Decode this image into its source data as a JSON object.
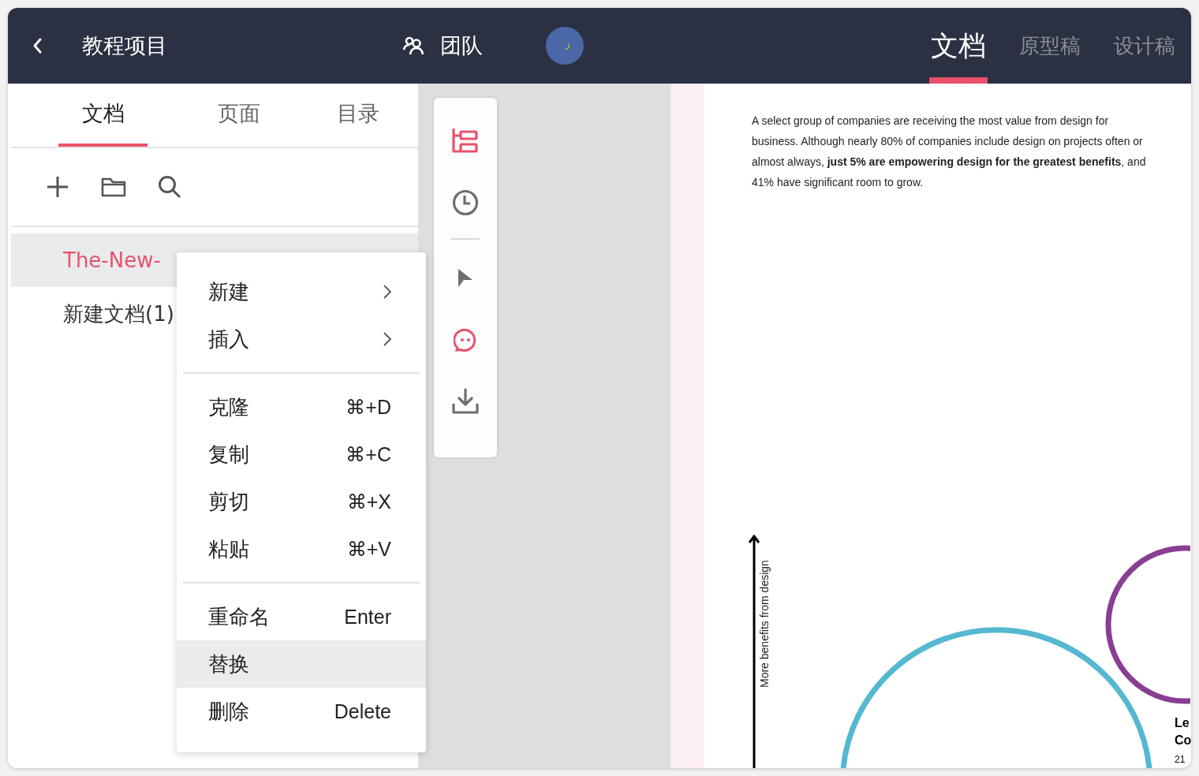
{
  "header": {
    "project_title": "教程项目",
    "team_label": "团队",
    "tabs": [
      {
        "label": "文档",
        "selected": true
      },
      {
        "label": "原型稿",
        "selected": false
      },
      {
        "label": "设计稿",
        "selected": false
      }
    ]
  },
  "sidebar": {
    "tabs": [
      {
        "label": "文档",
        "selected": true
      },
      {
        "label": "页面",
        "selected": false
      },
      {
        "label": "目录",
        "selected": false
      }
    ],
    "items": [
      {
        "label": "The-New-",
        "selected": true
      },
      {
        "label": "新建文档(1)",
        "selected": false
      }
    ]
  },
  "context_menu": {
    "groups": [
      [
        {
          "kind": "submenu",
          "label": "新建",
          "selected": false
        },
        {
          "kind": "submenu",
          "label": "插入",
          "selected": false
        }
      ],
      [
        {
          "kind": "shortcut",
          "label": "克隆",
          "shortcut": "⌘+D",
          "selected": false
        },
        {
          "kind": "shortcut",
          "label": "复制",
          "shortcut": "⌘+C",
          "selected": false
        },
        {
          "kind": "shortcut",
          "label": "剪切",
          "shortcut": "⌘+X",
          "selected": false
        },
        {
          "kind": "shortcut",
          "label": "粘贴",
          "shortcut": "⌘+V",
          "selected": false
        }
      ],
      [
        {
          "kind": "shortcut",
          "label": "重命名",
          "shortcut": "Enter",
          "selected": false
        },
        {
          "kind": "plain",
          "label": "替换",
          "selected": true
        },
        {
          "kind": "shortcut",
          "label": "删除",
          "shortcut": "Delete",
          "selected": false
        }
      ]
    ]
  },
  "toolbar": {
    "tools": [
      {
        "kind": "tree",
        "active": true
      },
      {
        "kind": "history",
        "active": false
      },
      {
        "kind": "divider"
      },
      {
        "kind": "pointer",
        "active": false
      },
      {
        "kind": "comment",
        "active": true
      },
      {
        "kind": "download",
        "active": false
      }
    ]
  },
  "document": {
    "paragraph": "A select group of companies are receiving the most value from design for business. Although nearly 80% of companies include design on projects often or almost always, **just 5% are empowering design for the greatest benefits**, and 41% have significant room to grow.",
    "axis_label": "More benefits from design",
    "cut_label_lines": [
      "Le",
      "Co"
    ],
    "cut_value": "21"
  }
}
